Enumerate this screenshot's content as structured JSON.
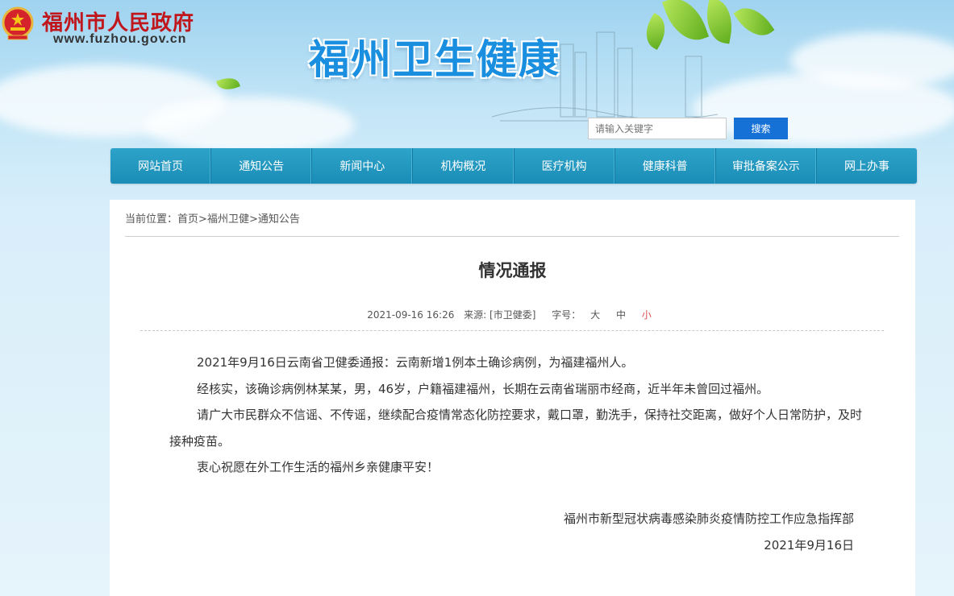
{
  "header": {
    "gov_name": "福州市人民政府",
    "gov_url": "www.fuzhou.gov.cn",
    "site_title": "福州卫生健康",
    "search": {
      "placeholder": "请输入关键字",
      "button_label": "搜索"
    },
    "colors": {
      "gov_red": "#c0171d",
      "title_blue": "#1a8fe0",
      "search_blue": "#1671d6",
      "nav_teal": "#1a8db6"
    }
  },
  "nav": {
    "items": [
      {
        "label": "网站首页"
      },
      {
        "label": "通知公告"
      },
      {
        "label": "新闻中心"
      },
      {
        "label": "机构概况"
      },
      {
        "label": "医疗机构"
      },
      {
        "label": "健康科普"
      },
      {
        "label": "审批备案公示"
      },
      {
        "label": "网上办事"
      }
    ]
  },
  "breadcrumb": {
    "prefix": "当前位置：",
    "items": [
      "首页",
      "福州卫健",
      "通知公告"
    ],
    "separator": ">"
  },
  "article": {
    "title": "情况通报",
    "date": "2021-09-16 16:26",
    "source_label": "来源:",
    "source": "[市卫健委]",
    "font_size_label": "字号：",
    "font_sizes": [
      "大",
      "中",
      "小"
    ],
    "paragraphs": [
      "2021年9月16日云南省卫健委通报：云南新增1例本土确诊病例，为福建福州人。",
      "经核实，该确诊病例林某某，男，46岁，户籍福建福州，长期在云南省瑞丽市经商，近半年未曾回过福州。",
      "请广大市民群众不信谣、不传谣，继续配合疫情常态化防控要求，戴口罩，勤洗手，保持社交距离，做好个人日常防护，及时接种疫苗。",
      "衷心祝愿在外工作生活的福州乡亲健康平安！"
    ],
    "signature": "福州市新型冠状病毒感染肺炎疫情防控工作应急指挥部",
    "signature_date": "2021年9月16日"
  }
}
